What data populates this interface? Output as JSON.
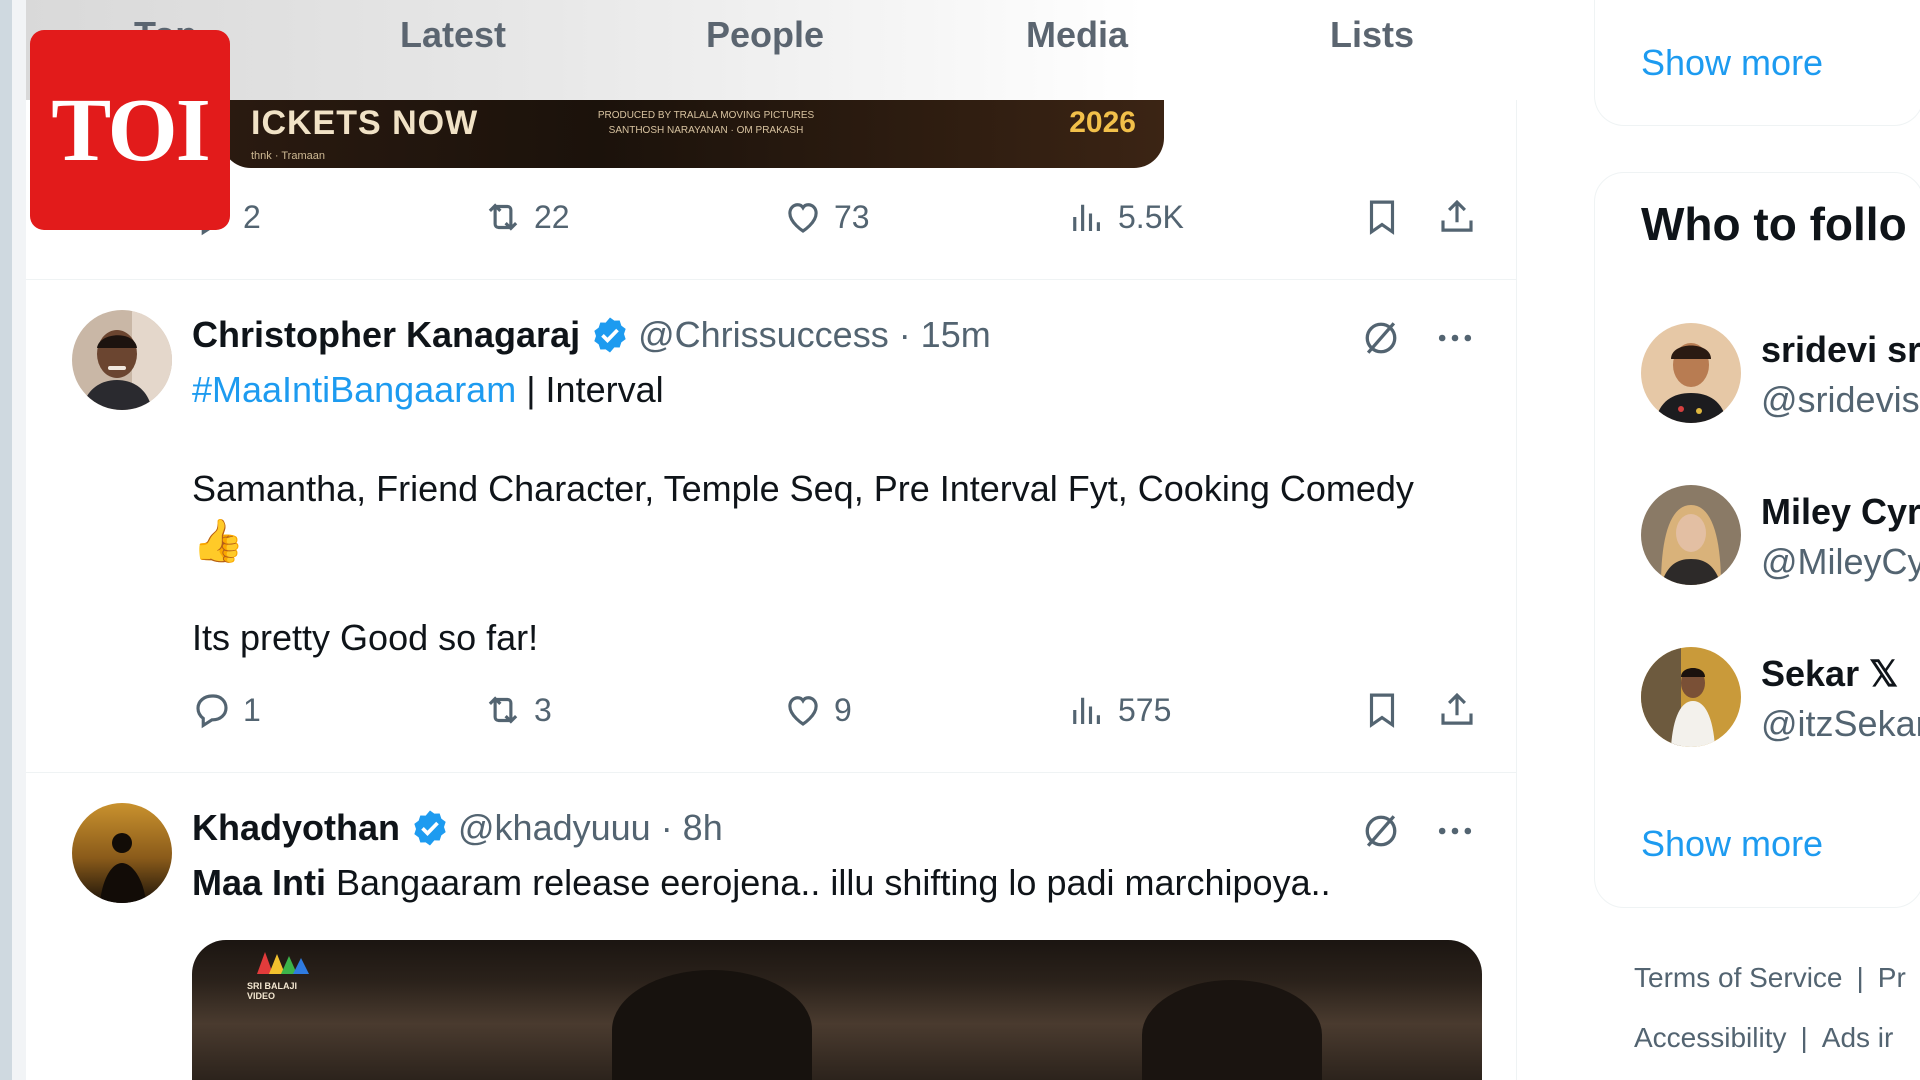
{
  "logo": {
    "text": "TOI"
  },
  "tabs": [
    {
      "label": "Top"
    },
    {
      "label": "Latest"
    },
    {
      "label": "People"
    },
    {
      "label": "Media"
    },
    {
      "label": "Lists"
    }
  ],
  "promo": {
    "title": "ICKETS NOW",
    "credits_line1": "PRODUCED BY TRALALA MOVING PICTURES",
    "credits_line2": "SANTHOSH NARAYANAN · OM PRAKASH",
    "year": "2026",
    "logos": "thnk · Tramaan"
  },
  "tweet0": {
    "replies": "2",
    "reposts": "22",
    "likes": "73",
    "views": "5.5K"
  },
  "tweet1": {
    "name": "Christopher Kanagaraj",
    "handle": "@Chrissuccess · 15m",
    "hashtag": "#MaaIntiBangaaram",
    "first_line_rest": " | Interval",
    "line2": "Samantha, Friend Character, Temple Seq, Pre Interval Fyt, Cooking Comedy",
    "emoji": "👍",
    "line3": "Its pretty Good so far!",
    "replies": "1",
    "reposts": "3",
    "likes": "9",
    "views": "575"
  },
  "tweet2": {
    "name": "Khadyothan",
    "handle": "@khadyuuu · 8h",
    "text_bold": "Maa Inti",
    "text_rest": " Bangaaram release eerojena.. illu shifting lo padi marchipoya..",
    "media_watermark": "SRI BALAJI VIDEO"
  },
  "sidebar": {
    "top_show_more": "Show more",
    "who_to_follow_title": "Who to follo",
    "suggestions": [
      {
        "name": "sridevi sr",
        "handle": "@sridevis"
      },
      {
        "name": "Miley Cyr",
        "handle": "@MileyCy"
      },
      {
        "name": "Sekar 𝕏",
        "handle": "@itzSekar"
      }
    ],
    "bottom_show_more": "Show more",
    "footer_row1": [
      "Terms of Service",
      "|",
      "Pr"
    ],
    "footer_row2": [
      "Accessibility",
      "|",
      "Ads ir"
    ]
  },
  "colors": {
    "accent": "#1d9bf0",
    "secondary_text": "#536471",
    "logo_red": "#e21b1b"
  }
}
